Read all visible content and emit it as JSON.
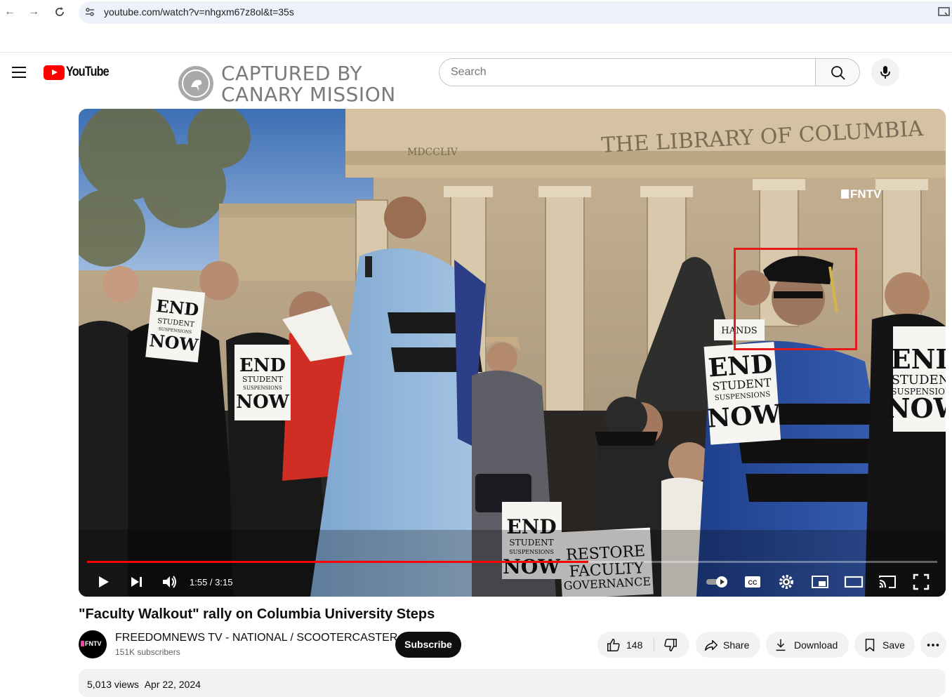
{
  "browser": {
    "url": "youtube.com/watch?v=nhgxm67z8ol&t=35s"
  },
  "header": {
    "logo_text": "YouTube",
    "search_placeholder": "Search"
  },
  "watermark": {
    "line1": "CAPTURED BY",
    "line2": "CANARY MISSION"
  },
  "player": {
    "channel_bug": "FNTV",
    "current_time": "1:55",
    "duration": "3:15",
    "time_display": "1:55 / 3:15",
    "progress_fraction": 0.59,
    "signs": {
      "end1": "END",
      "student": "STUDENT",
      "suspensions": "SUSPENSIONS",
      "now": "NOW",
      "hands": "HANDS",
      "restore": "RESTORE",
      "faculty": "FACULTY",
      "governance": "GOVERNANCE",
      "building": "THE LIBRARY OF COLUMBIA",
      "roman": "MDCCLIV"
    }
  },
  "video": {
    "title": "\"Faculty Walkout\" rally on Columbia University Steps",
    "channel_name": "FREEDOMNEWS TV - NATIONAL / SCOOTERCASTER",
    "channel_avatar_text": "FNTV",
    "subscribers": "151K subscribers",
    "subscribe_label": "Subscribe",
    "like_count": "148",
    "share_label": "Share",
    "download_label": "Download",
    "save_label": "Save",
    "views": "5,013 views",
    "date": "Apr 22, 2024"
  },
  "colors": {
    "youtube_red": "#ff0000",
    "highlight_box": "#e41b1b"
  }
}
